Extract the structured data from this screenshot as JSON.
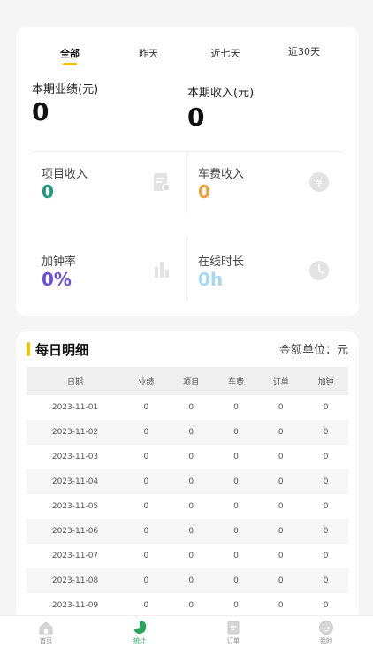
{
  "tabs": [
    {
      "label": "全部",
      "active": true
    },
    {
      "label": "昨天",
      "active": false
    },
    {
      "label": "近七天",
      "active": false
    },
    {
      "label": "近30天",
      "active": false
    }
  ],
  "summary": {
    "performance_label": "本期业绩(元)",
    "performance_value": "0",
    "income_label": "本期收入(元)",
    "income_value": "0"
  },
  "metrics": {
    "project_income": {
      "label": "项目收入",
      "value": "0",
      "color": "#1a9a7e"
    },
    "fare_income": {
      "label": "车费收入",
      "value": "0",
      "color": "#f0a040"
    },
    "overtime_rate": {
      "label": "加钟率",
      "value": "0%",
      "color": "#6b4fd8"
    },
    "online_duration": {
      "label": "在线时长",
      "value": "0h",
      "color": "#a6d8f2"
    }
  },
  "detail": {
    "title": "每日明细",
    "unit_label": "金额单位：元",
    "columns": [
      "日期",
      "业绩",
      "项目",
      "车费",
      "订单",
      "加钟"
    ],
    "rows": [
      [
        "2023-11-01",
        "0",
        "0",
        "0",
        "0",
        "0"
      ],
      [
        "2023-11-02",
        "0",
        "0",
        "0",
        "0",
        "0"
      ],
      [
        "2023-11-03",
        "0",
        "0",
        "0",
        "0",
        "0"
      ],
      [
        "2023-11-04",
        "0",
        "0",
        "0",
        "0",
        "0"
      ],
      [
        "2023-11-05",
        "0",
        "0",
        "0",
        "0",
        "0"
      ],
      [
        "2023-11-06",
        "0",
        "0",
        "0",
        "0",
        "0"
      ],
      [
        "2023-11-07",
        "0",
        "0",
        "0",
        "0",
        "0"
      ],
      [
        "2023-11-08",
        "0",
        "0",
        "0",
        "0",
        "0"
      ],
      [
        "2023-11-09",
        "0",
        "0",
        "0",
        "0",
        "0"
      ]
    ]
  },
  "nav": [
    {
      "label": "首页",
      "icon": "home-icon",
      "active": false
    },
    {
      "label": "统计",
      "icon": "pie-chart-icon",
      "active": true
    },
    {
      "label": "订单",
      "icon": "order-icon",
      "active": false
    },
    {
      "label": "我的",
      "icon": "profile-icon",
      "active": false
    }
  ],
  "colors": {
    "accent": "#f2c200",
    "active_nav": "#26a65b"
  }
}
